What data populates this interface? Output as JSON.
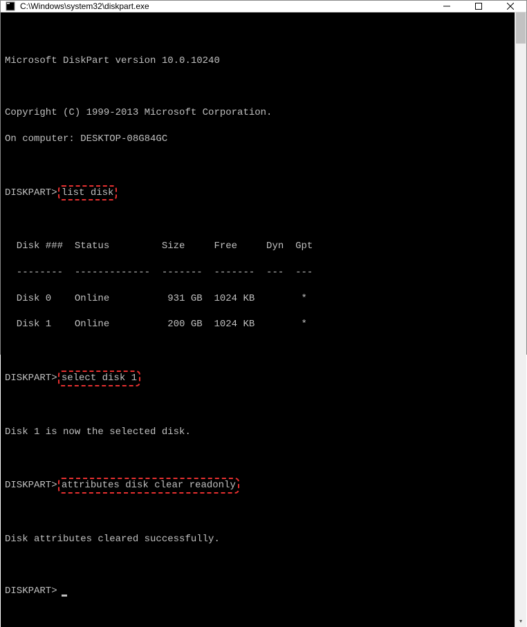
{
  "window": {
    "title": "C:\\Windows\\system32\\diskpart.exe"
  },
  "terminal": {
    "version_line": "Microsoft DiskPart version 10.0.10240",
    "copyright_line": "Copyright (C) 1999-2013 Microsoft Corporation.",
    "computer_line": "On computer: DESKTOP-08G84GC",
    "prompt": "DISKPART>",
    "commands": {
      "cmd1": "list disk",
      "cmd2": "select disk 1",
      "cmd3": "attributes disk clear readonly"
    },
    "table": {
      "header": "  Disk ###  Status         Size     Free     Dyn  Gpt",
      "divider": "  --------  -------------  -------  -------  ---  ---",
      "rows": [
        "  Disk 0    Online          931 GB  1024 KB        *",
        "  Disk 1    Online          200 GB  1024 KB        *"
      ]
    },
    "response1": "Disk 1 is now the selected disk.",
    "response2": "Disk attributes cleared successfully."
  }
}
